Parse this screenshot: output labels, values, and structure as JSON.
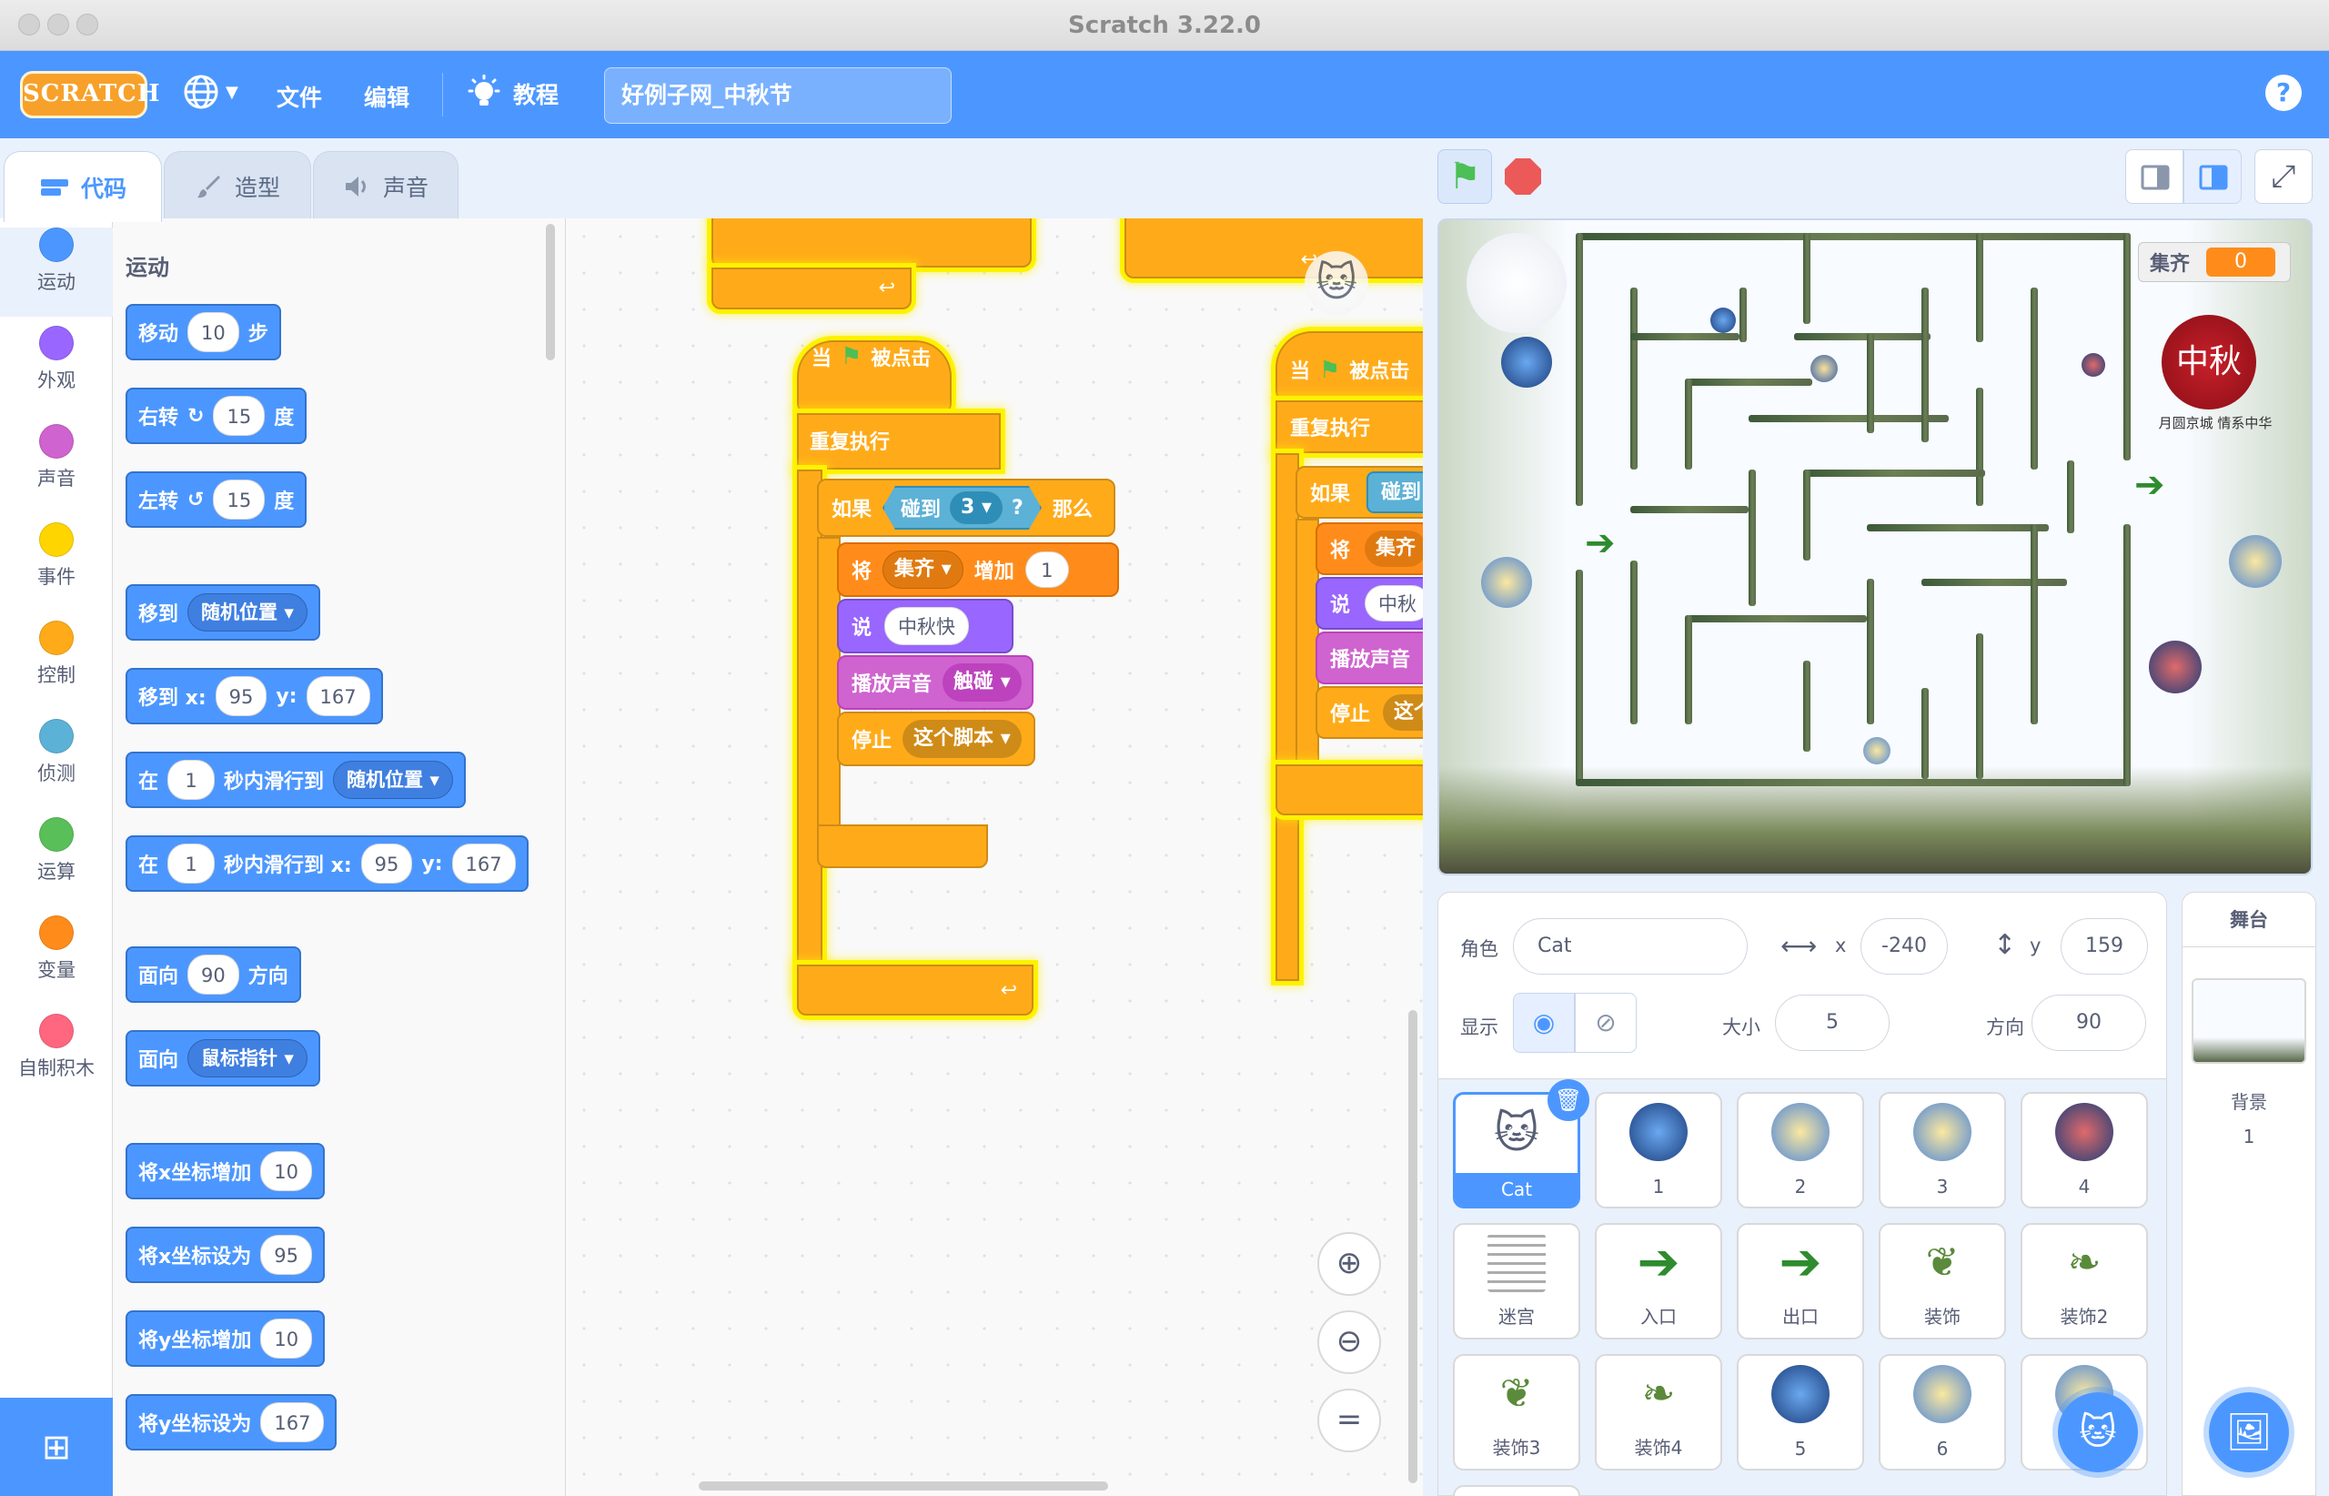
{
  "window": {
    "title": "Scratch 3.22.0"
  },
  "menubar": {
    "logo": "SCRATCH",
    "file": "文件",
    "edit": "编辑",
    "tutorials": "教程",
    "project_name": "好例子网_中秋节",
    "help": "?"
  },
  "tabs": [
    {
      "label": "代码"
    },
    {
      "label": "造型"
    },
    {
      "label": "声音"
    }
  ],
  "categories": [
    {
      "label": "运动",
      "color": "#4c97ff"
    },
    {
      "label": "外观",
      "color": "#9966ff"
    },
    {
      "label": "声音",
      "color": "#cf63cf"
    },
    {
      "label": "事件",
      "color": "#ffd500"
    },
    {
      "label": "控制",
      "color": "#ffab19"
    },
    {
      "label": "侦测",
      "color": "#5cb1d6"
    },
    {
      "label": "运算",
      "color": "#59c059"
    },
    {
      "label": "变量",
      "color": "#ff8c1a"
    },
    {
      "label": "自制积木",
      "color": "#ff6680"
    }
  ],
  "palette": {
    "section": "运动",
    "move": {
      "a": "移动",
      "v": "10",
      "b": "步"
    },
    "turn_right": {
      "a": "右转",
      "v": "15",
      "b": "度"
    },
    "turn_left": {
      "a": "左转",
      "v": "15",
      "b": "度"
    },
    "goto": {
      "a": "移到",
      "d": "随机位置"
    },
    "goto_xy": {
      "a": "移到 x:",
      "x": "95",
      "y_label": "y:",
      "y": "167"
    },
    "glide_to": {
      "a": "在",
      "v": "1",
      "b": "秒内滑行到",
      "d": "随机位置"
    },
    "glide_xy": {
      "a": "在",
      "v": "1",
      "b": "秒内滑行到 x:",
      "x": "95",
      "y_label": "y:",
      "y": "167"
    },
    "point_dir": {
      "a": "面向",
      "v": "90",
      "b": "方向"
    },
    "point_towards": {
      "a": "面向",
      "d": "鼠标指针"
    },
    "change_x": {
      "a": "将x坐标增加",
      "v": "10"
    },
    "set_x": {
      "a": "将x坐标设为",
      "v": "95"
    },
    "change_y": {
      "a": "将y坐标增加",
      "v": "10"
    },
    "set_y": {
      "a": "将y坐标设为",
      "v": "167"
    }
  },
  "script1": {
    "hat_when": "当",
    "hat_clicked": "被点击",
    "forever": "重复执行",
    "if": "如果",
    "touching": "碰到",
    "touching_target": "3",
    "q": "?",
    "then": "那么",
    "change": "将",
    "var": "集齐",
    "by": "增加",
    "by_value": "1",
    "say": "说",
    "say_text": "中秋快",
    "play_sound": "播放声音",
    "sound": "触碰",
    "stop": "停止",
    "stop_what": "这个脚本"
  },
  "script2": {
    "hat_when": "当",
    "hat_clicked": "被点击",
    "forever": "重复执行",
    "if": "如果",
    "touching": "碰到",
    "change": "将",
    "var": "集齐",
    "say": "说",
    "say_text": "中秋",
    "play_sound": "播放声音",
    "stop": "停止",
    "stop_what": "这个"
  },
  "stage": {
    "monitor_label": "集齐",
    "monitor_value": "0",
    "badge_text": "中秋",
    "badge_sub": "月圆京城 情系中华"
  },
  "sprite_info": {
    "sprite_label": "角色",
    "sprite_name": "Cat",
    "x_label": "x",
    "x": "-240",
    "y_label": "y",
    "y": "159",
    "show_label": "显示",
    "size_label": "大小",
    "size": "5",
    "direction_label": "方向",
    "direction": "90"
  },
  "sprites": [
    {
      "name": "Cat"
    },
    {
      "name": "1"
    },
    {
      "name": "2"
    },
    {
      "name": "3"
    },
    {
      "name": "4"
    },
    {
      "name": "迷宫"
    },
    {
      "name": "入口"
    },
    {
      "name": "出口"
    },
    {
      "name": "装饰"
    },
    {
      "name": "装饰2"
    },
    {
      "name": "装饰3"
    },
    {
      "name": "装饰4"
    },
    {
      "name": "5"
    },
    {
      "name": "6"
    },
    {
      "name": ""
    }
  ],
  "stage_panel": {
    "title": "舞台",
    "backdrop_label": "背景",
    "backdrop_count": "1"
  }
}
